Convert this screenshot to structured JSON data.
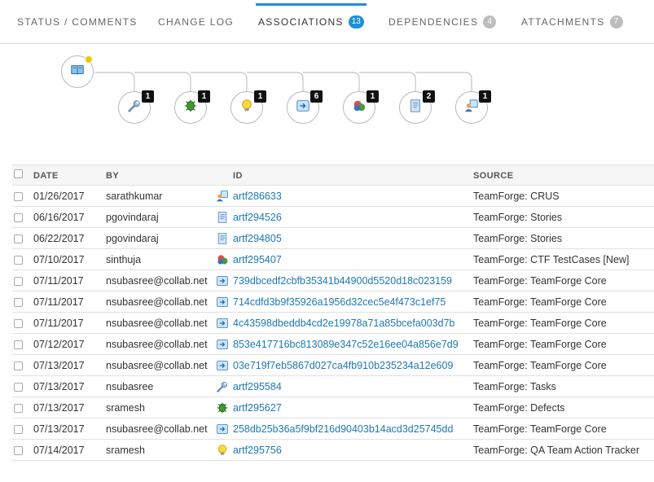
{
  "tabs": [
    {
      "label": "STATUS / COMMENTS",
      "badge": null,
      "active": false
    },
    {
      "label": "CHANGE LOG",
      "badge": null,
      "active": false
    },
    {
      "label": "ASSOCIATIONS",
      "badge": "13",
      "active": true
    },
    {
      "label": "DEPENDENCIES",
      "badge": "4",
      "active": false
    },
    {
      "label": "ATTACHMENTS",
      "badge": "7",
      "active": false
    }
  ],
  "diagram": {
    "root_icon": "book-icon",
    "children": [
      {
        "icon": "wrench-icon",
        "count": "1"
      },
      {
        "icon": "bug-icon",
        "count": "1"
      },
      {
        "icon": "lightbulb-icon",
        "count": "1"
      },
      {
        "icon": "commit-icon",
        "count": "6"
      },
      {
        "icon": "testcase-icon",
        "count": "1"
      },
      {
        "icon": "story-icon",
        "count": "2"
      },
      {
        "icon": "user-task-icon",
        "count": "1"
      }
    ]
  },
  "table": {
    "headers": {
      "date": "DATE",
      "by": "BY",
      "id": "ID",
      "source": "SOURCE"
    },
    "rows": [
      {
        "date": "01/26/2017",
        "by": "sarathkumar",
        "icon": "user-task-icon",
        "id": "artf286633",
        "source": "TeamForge: CRUS"
      },
      {
        "date": "06/16/2017",
        "by": "pgovindaraj",
        "icon": "story-icon",
        "id": "artf294526",
        "source": "TeamForge: Stories"
      },
      {
        "date": "06/22/2017",
        "by": "pgovindaraj",
        "icon": "story-icon",
        "id": "artf294805",
        "source": "TeamForge: Stories"
      },
      {
        "date": "07/10/2017",
        "by": "sinthuja",
        "icon": "testcase-icon",
        "id": "artf295407",
        "source": "TeamForge: CTF TestCases [New]"
      },
      {
        "date": "07/11/2017",
        "by": "nsubasree@collab.net",
        "icon": "commit-icon",
        "id": "739dbcedf2cbfb35341b44900d5520d18c023159",
        "source": "TeamForge: TeamForge Core"
      },
      {
        "date": "07/11/2017",
        "by": "nsubasree@collab.net",
        "icon": "commit-icon",
        "id": "714cdfd3b9f35926a1956d32cec5e4f473c1ef75",
        "source": "TeamForge: TeamForge Core"
      },
      {
        "date": "07/11/2017",
        "by": "nsubasree@collab.net",
        "icon": "commit-icon",
        "id": "4c43598dbeddb4cd2e19978a71a85bcefa003d7b",
        "source": "TeamForge: TeamForge Core"
      },
      {
        "date": "07/12/2017",
        "by": "nsubasree@collab.net",
        "icon": "commit-icon",
        "id": "853e417716bc813089e347c52e16ee04a856e7d9",
        "source": "TeamForge: TeamForge Core"
      },
      {
        "date": "07/13/2017",
        "by": "nsubasree@collab.net",
        "icon": "commit-icon",
        "id": "03e719f7eb5867d027ca4fb910b235234a12e609",
        "source": "TeamForge: TeamForge Core"
      },
      {
        "date": "07/13/2017",
        "by": "nsubasree",
        "icon": "wrench-icon",
        "id": "artf295584",
        "source": "TeamForge: Tasks"
      },
      {
        "date": "07/13/2017",
        "by": "sramesh",
        "icon": "bug-icon",
        "id": "artf295627",
        "source": "TeamForge: Defects"
      },
      {
        "date": "07/13/2017",
        "by": "nsubasree@collab.net",
        "icon": "commit-icon",
        "id": "258db25b36a5f9bf216d90403b14acd3d25745dd",
        "source": "TeamForge: TeamForge Core"
      },
      {
        "date": "07/14/2017",
        "by": "sramesh",
        "icon": "lightbulb-icon",
        "id": "artf295756",
        "source": "TeamForge: QA Team Action Tracker"
      }
    ]
  }
}
